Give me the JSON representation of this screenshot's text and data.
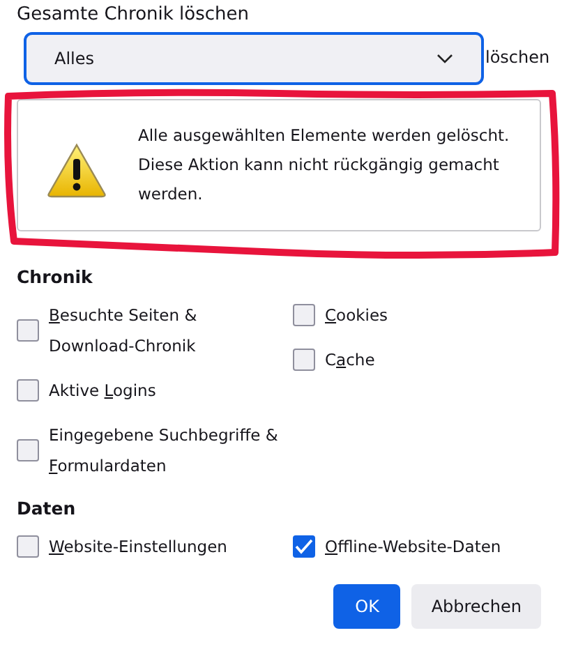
{
  "title": "Gesamte Chronik löschen",
  "range": {
    "value": "Alles",
    "covered_label": "löschen"
  },
  "warning": {
    "lines": [
      "Alle ausgewählten Elemente werden gelöscht.",
      "Diese Aktion kann nicht rückgängig gemacht werden."
    ]
  },
  "annotation": {
    "kind": "outline"
  },
  "sections": [
    {
      "heading": "Chronik",
      "columns": [
        [
          {
            "key": "B",
            "post": "esuchte Seiten & Download-Chronik",
            "checked": false
          },
          {
            "pre": "Aktive ",
            "key": "L",
            "post": "ogins",
            "checked": false
          },
          {
            "pre": "Eingegebene Suchbegriffe & ",
            "key": "F",
            "post": "ormulardaten",
            "checked": false
          }
        ],
        [
          {
            "key": "C",
            "post": "ookies",
            "checked": false
          },
          {
            "pre": "C",
            "key": "a",
            "post": "che",
            "checked": false
          }
        ]
      ]
    },
    {
      "heading": "Daten",
      "columns": [
        [
          {
            "key": "W",
            "post": "ebsite-Einstellungen",
            "checked": false
          }
        ],
        [
          {
            "key": "O",
            "post": "ffline-Website-Daten",
            "checked": true
          }
        ]
      ]
    }
  ],
  "buttons": [
    {
      "label": "OK",
      "kind": "primary"
    },
    {
      "label": "Abbrechen",
      "kind": "secondary"
    }
  ]
}
